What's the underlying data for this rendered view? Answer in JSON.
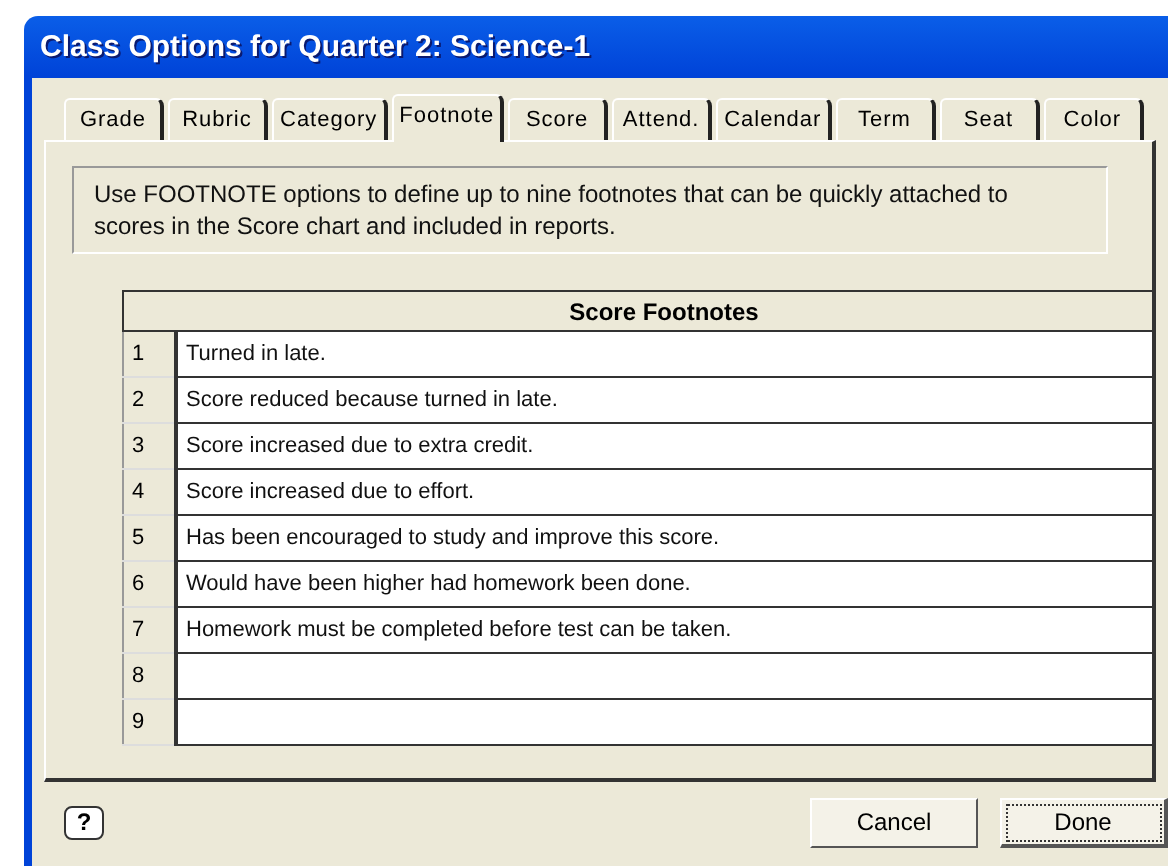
{
  "window": {
    "title": "Class Options for Quarter 2: Science-1"
  },
  "tabs": [
    {
      "label": "Grade",
      "selected": false
    },
    {
      "label": "Rubric",
      "selected": false
    },
    {
      "label": "Category",
      "selected": false
    },
    {
      "label": "Footnote",
      "selected": true
    },
    {
      "label": "Score",
      "selected": false
    },
    {
      "label": "Attend.",
      "selected": false
    },
    {
      "label": "Calendar",
      "selected": false
    },
    {
      "label": "Term",
      "selected": false
    },
    {
      "label": "Seat",
      "selected": false
    },
    {
      "label": "Color",
      "selected": false
    }
  ],
  "info": "Use FOOTNOTE options to define up to nine footnotes that can be quickly attached to scores in the Score chart and included in reports.",
  "table": {
    "columns": [
      "Score Footnotes"
    ],
    "rows": [
      {
        "number": "1",
        "text": "Turned in late."
      },
      {
        "number": "2",
        "text": "Score reduced because turned in late."
      },
      {
        "number": "3",
        "text": "Score increased due to extra credit."
      },
      {
        "number": "4",
        "text": "Score increased due to effort."
      },
      {
        "number": "5",
        "text": "Has been encouraged to study and improve this score."
      },
      {
        "number": "6",
        "text": "Would have been higher had homework been done."
      },
      {
        "number": "7",
        "text": "Homework must be completed before test can be taken."
      },
      {
        "number": "8"
      },
      {
        "number": "9"
      }
    ]
  },
  "help_button": "?",
  "buttons": [
    {
      "label": "Cancel",
      "default": false
    },
    {
      "label": "Done",
      "default": true
    }
  ]
}
